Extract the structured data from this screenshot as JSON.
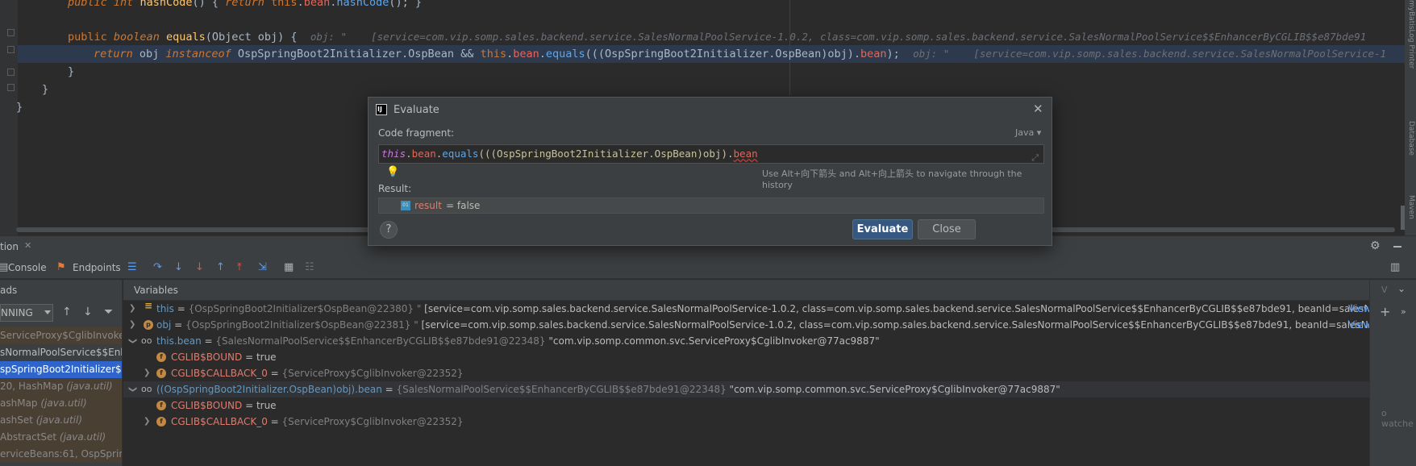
{
  "editor": {
    "line1": {
      "kw1": "public",
      "kw2": "int",
      "method": "hashCode",
      "body": "() { ",
      "ret": "return",
      "thisk": "this",
      "field": "bean",
      "call": "hashCode",
      "tail": "(); }"
    },
    "line2": {
      "kw1": "public",
      "kw2": "boolean",
      "method": "equals",
      "params": "(Object obj) {",
      "hint": "obj: \"    [service=com.vip.somp.sales.backend.service.SalesNormalPoolService-1.0.2, class=com.vip.somp.sales.backend.service.SalesNormalPoolService$$EnhancerByCGLIB$$e87bde91"
    },
    "line3": {
      "ret": "return",
      "rest1": " obj ",
      "inst": "instanceof",
      "cls": " OspSpringBoot2Initializer.OspBean && ",
      "thisk": "this",
      "dot1": ".",
      "field": "bean",
      "dot2": ".",
      "call": "equals",
      "rest2": "(((OspSpringBoot2Initializer.OspBean)obj).",
      "field2": "bean",
      "rest3": ");",
      "hint": "obj: \"    [service=com.vip.somp.sales.backend.service.SalesNormalPoolService-1"
    },
    "line4": "}",
    "line5": "}",
    "line6": "}",
    "side_labels": [
      "myBatisLog Printer",
      "Database",
      "Maven"
    ]
  },
  "tool_window": {
    "tab_title": "tion",
    "console_label": "Console",
    "endpoints_label": "Endpoints"
  },
  "frames": {
    "title": "ads",
    "thread_value": "NNING",
    "items": [
      {
        "text": "ServiceProxy$CglibInvoker",
        "italic": "",
        "state": "dim"
      },
      {
        "text": "sNormalPoolService$$Enh",
        "italic": "",
        "state": "normal"
      },
      {
        "text": "spSpringBoot2Initializer$Os",
        "italic": "",
        "state": "sel"
      },
      {
        "text": "20, HashMap ",
        "italic": "(java.util)",
        "state": "dim"
      },
      {
        "text": "ashMap ",
        "italic": "(java.util)",
        "state": "dim"
      },
      {
        "text": "ashSet ",
        "italic": "(java.util)",
        "state": "dim"
      },
      {
        "text": " AbstractSet ",
        "italic": "(java.util)",
        "state": "dim"
      },
      {
        "text": "erviceBeans:61, OspSpring",
        "italic": "",
        "state": "dim"
      }
    ]
  },
  "variables": {
    "title": "Variables",
    "rows": [
      {
        "name": "this",
        "eq": " = ",
        "type": "{OspSpringBoot2Initializer$OspBean@22380} \"",
        "value": "   [service=com.vip.somp.sales.backend.service.SalesNormalPoolService-1.0.2, class=com.vip.somp.sales.backend.service.SalesNormalPoolService$$EnhancerByCGLIB$$e87bde91, beanId=salesNorr...",
        "link": "View"
      },
      {
        "name": "obj",
        "eq": " = ",
        "type": "{OspSpringBoot2Initializer$OspBean@22381} \"",
        "value": "   [service=com.vip.somp.sales.backend.service.SalesNormalPoolService-1.0.2, class=com.vip.somp.sales.backend.service.SalesNormalPoolService$$EnhancerByCGLIB$$e87bde91, beanId=salesNorr...",
        "link": "View"
      },
      {
        "name": "this.bean",
        "eq": " = ",
        "type": "{SalesNormalPoolService$$EnhancerByCGLIB$$e87bde91@22348}",
        "value": " \"com.vip.somp.common.svc.ServiceProxy$CglibInvoker@77ac9887\""
      },
      {
        "name": "CGLIB$BOUND",
        "eq": " = ",
        "type": "",
        "value": "true"
      },
      {
        "name": "CGLIB$CALLBACK_0",
        "eq": " = ",
        "type": "{ServiceProxy$CglibInvoker@22352}",
        "value": ""
      },
      {
        "name": "((OspSpringBoot2Initializer.OspBean)obj).bean",
        "eq": " = ",
        "type": "{SalesNormalPoolService$$EnhancerByCGLIB$$e87bde91@22348}",
        "value": " \"com.vip.somp.common.svc.ServiceProxy$CglibInvoker@77ac9887\""
      },
      {
        "name": "CGLIB$BOUND",
        "eq": " = ",
        "type": "",
        "value": "true"
      },
      {
        "name": "CGLIB$CALLBACK_0",
        "eq": " = ",
        "type": "{ServiceProxy$CglibInvoker@22352}",
        "value": ""
      }
    ]
  },
  "watches": {
    "empty_text": "o watche",
    "tab": "V"
  },
  "evaluate_dialog": {
    "title": "Evaluate",
    "fragment_label": "Code fragment:",
    "language": "Java",
    "code": {
      "thisk": "this",
      "d1": ".",
      "f1": "bean",
      "d2": ".",
      "m": "equals",
      "mid": "(((OspSpringBoot2Initializer.OspBean)obj).",
      "f2": "bean"
    },
    "history_hint": "Use Alt+向下箭头 and Alt+向上箭头 to navigate through the history",
    "result_label": "Result:",
    "result_name": "result",
    "result_eq": " = false",
    "evaluate_button": "Evaluate",
    "close_button": "Close",
    "help": "?"
  }
}
